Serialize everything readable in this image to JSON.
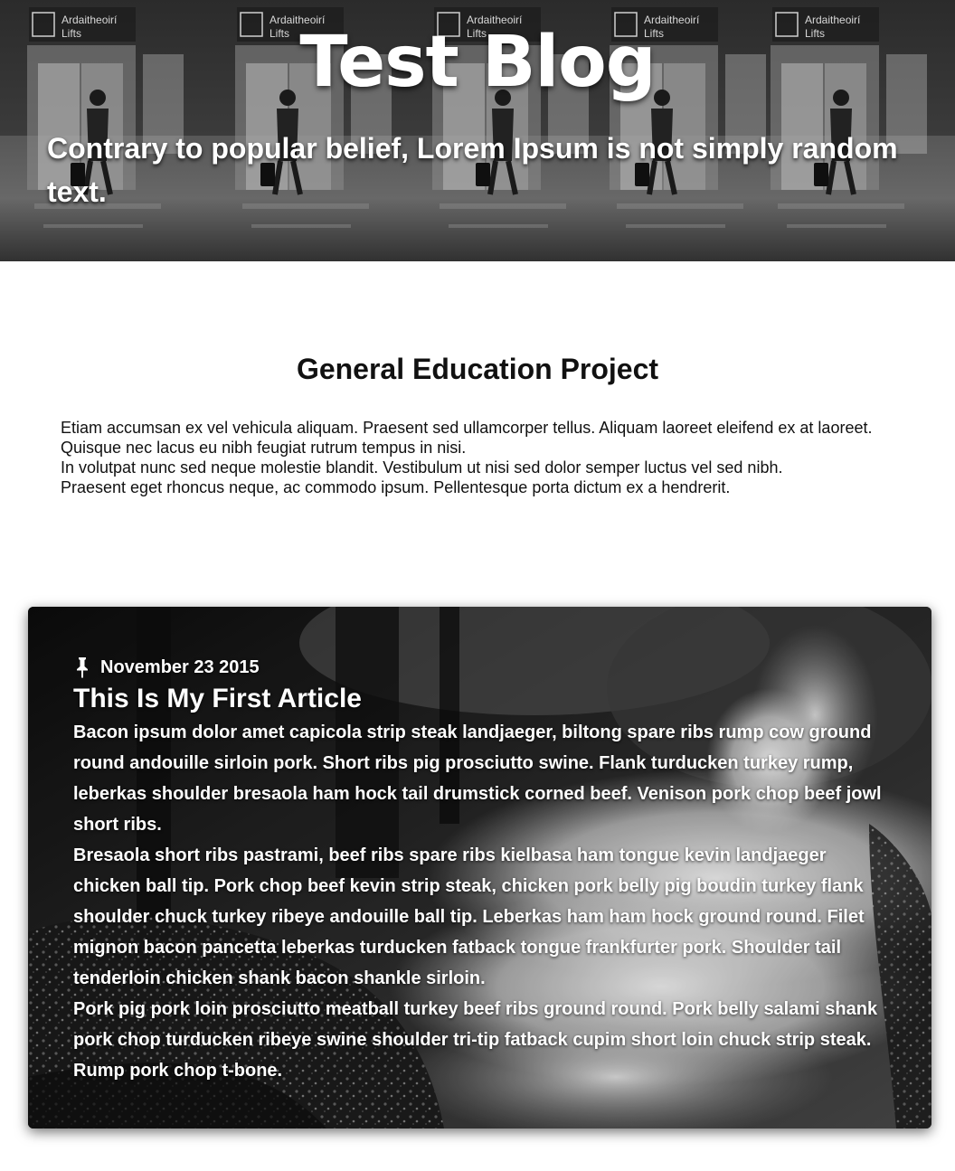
{
  "header": {
    "title": "Test Blog",
    "subtitle": "Contrary to popular belief, Lorem Ipsum is not simply random text.",
    "sign_text_line1": "Ardaitheoirí",
    "sign_text_line2": "Lifts"
  },
  "intro": {
    "heading": "General Education Project",
    "paragraphs": [
      "Etiam accumsan ex vel vehicula aliquam. Praesent sed ullamcorper tellus. Aliquam laoreet eleifend ex at laoreet.",
      "Quisque nec lacus eu nibh feugiat rutrum tempus in nisi.",
      "In volutpat nunc sed neque molestie blandit. Vestibulum ut nisi sed dolor semper luctus vel sed nibh.",
      "Praesent eget rhoncus neque, ac commodo ipsum. Pellentesque porta dictum ex a hendrerit."
    ]
  },
  "article": {
    "date": "November 23 2015",
    "date_icon": "pin-icon",
    "title": "This Is My First Article",
    "paragraphs": [
      "Bacon ipsum dolor amet capicola strip steak landjaeger, biltong spare ribs rump cow ground round andouille sirloin pork. Short ribs pig prosciutto swine. Flank turducken turkey rump, leberkas shoulder bresaola ham hock tail drumstick corned beef. Venison pork chop beef jowl short ribs.",
      "Bresaola short ribs pastrami, beef ribs spare ribs kielbasa ham tongue kevin landjaeger chicken ball tip. Pork chop beef kevin strip steak, chicken pork belly pig boudin turkey flank shoulder chuck turkey ribeye andouille ball tip. Leberkas ham ham hock ground round. Filet mignon bacon pancetta leberkas turducken fatback tongue frankfurter pork. Shoulder tail tenderloin chicken shank bacon shankle sirloin.",
      "Pork pig pork loin prosciutto meatball turkey beef ribs ground round. Pork belly salami shank pork chop turducken ribeye swine shoulder tri-tip fatback cupim short loin chuck strip steak. Rump pork chop t-bone."
    ]
  },
  "colors": {
    "page_background": "#ffffff",
    "text_dark": "#111111",
    "text_light": "#ffffff"
  }
}
